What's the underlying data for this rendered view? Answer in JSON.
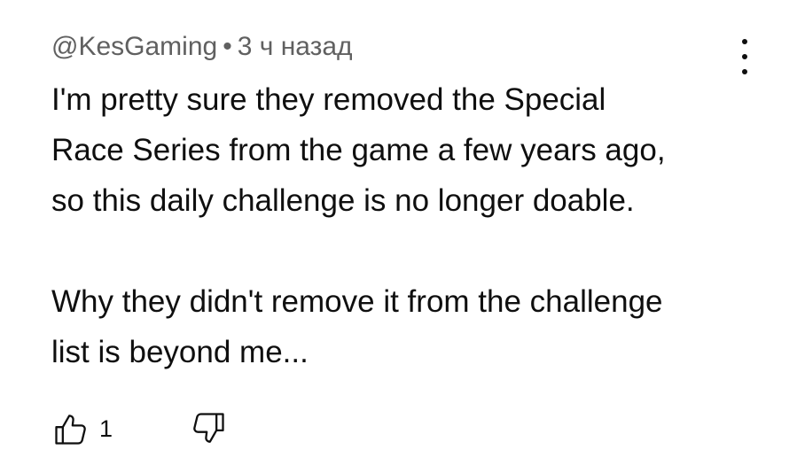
{
  "comment": {
    "author": "@KesGaming",
    "separator": "•",
    "time": "3 ч назад",
    "paragraphs": [
      "I'm pretty sure they removed the Special\nRace Series from the game a few years ago,\nso this daily challenge is no longer doable.",
      "Why they didn't remove it from the challenge\nlist is beyond me..."
    ],
    "like_count": "1"
  },
  "icons": {
    "menu": "more-vertical-icon",
    "like": "thumbs-up-icon",
    "dislike": "thumbs-down-icon"
  },
  "colors": {
    "text": "#0f0f0f",
    "meta": "#606060",
    "background": "#ffffff"
  }
}
